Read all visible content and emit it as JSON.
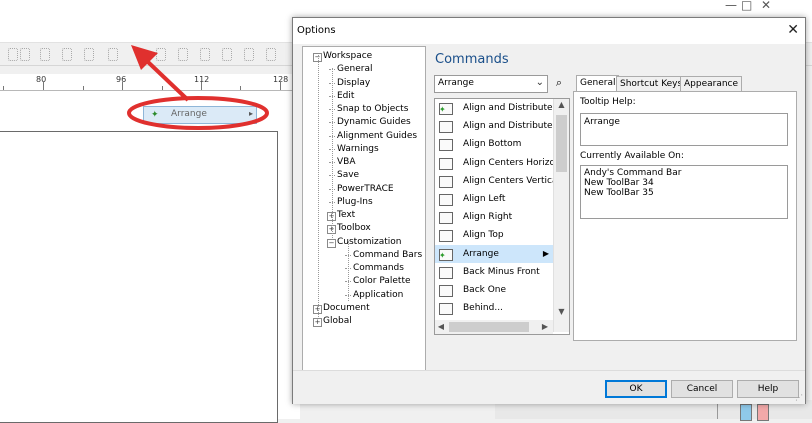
{
  "background": {
    "ruler_labels": [
      "80",
      "96",
      "112",
      "128"
    ],
    "arrange_chip_label": "Arrange",
    "window_controls": [
      "—",
      "□",
      "✕"
    ]
  },
  "dialog": {
    "title": "Options",
    "close_glyph": "✕",
    "tree": [
      {
        "label": "Workspace",
        "level": 0,
        "toggle": "−"
      },
      {
        "label": "General",
        "level": 1
      },
      {
        "label": "Display",
        "level": 1
      },
      {
        "label": "Edit",
        "level": 1
      },
      {
        "label": "Snap to Objects",
        "level": 1
      },
      {
        "label": "Dynamic Guides",
        "level": 1
      },
      {
        "label": "Alignment Guides",
        "level": 1
      },
      {
        "label": "Warnings",
        "level": 1
      },
      {
        "label": "VBA",
        "level": 1
      },
      {
        "label": "Save",
        "level": 1
      },
      {
        "label": "PowerTRACE",
        "level": 1
      },
      {
        "label": "Plug-Ins",
        "level": 1
      },
      {
        "label": "Text",
        "level": 1,
        "toggle": "+"
      },
      {
        "label": "Toolbox",
        "level": 1,
        "toggle": "+"
      },
      {
        "label": "Customization",
        "level": 1,
        "toggle": "−"
      },
      {
        "label": "Command Bars",
        "level": 2
      },
      {
        "label": "Commands",
        "level": 2
      },
      {
        "label": "Color Palette",
        "level": 2
      },
      {
        "label": "Application",
        "level": 2
      },
      {
        "label": "Document",
        "level": 0,
        "toggle": "+"
      },
      {
        "label": "Global",
        "level": 0,
        "toggle": "+"
      }
    ],
    "panel_title": "Commands",
    "dropdown_value": "Arrange",
    "search_glyph": "⌕",
    "commands": [
      {
        "label": "Align and Distribute",
        "selected": false
      },
      {
        "label": "Align and Distribute ...",
        "selected": false
      },
      {
        "label": "Align Bottom",
        "selected": false
      },
      {
        "label": "Align Centers Horizont",
        "selected": false
      },
      {
        "label": "Align Centers Vertical",
        "selected": false
      },
      {
        "label": "Align Left",
        "selected": false
      },
      {
        "label": "Align Right",
        "selected": false
      },
      {
        "label": "Align Top",
        "selected": false
      },
      {
        "label": "Arrange",
        "selected": true
      },
      {
        "label": "Back Minus Front",
        "selected": false
      },
      {
        "label": "Back One",
        "selected": false
      },
      {
        "label": "Behind...",
        "selected": false
      }
    ],
    "tabs": [
      {
        "label": "General",
        "active": true
      },
      {
        "label": "Shortcut Keys",
        "active": false
      },
      {
        "label": "Appearance",
        "active": false
      }
    ],
    "tooltip_help_label": "Tooltip Help:",
    "tooltip_help_value": "Arrange",
    "available_on_label": "Currently Available On:",
    "available_on_values": [
      "Andy's Command Bar",
      "New ToolBar 34",
      "New ToolBar 35"
    ],
    "buttons": {
      "ok": "OK",
      "cancel": "Cancel",
      "help": "Help"
    }
  },
  "colors": {
    "panel_title": "#1a4f8a",
    "selection": "#cde6fb",
    "annotation": "#e0302e"
  }
}
